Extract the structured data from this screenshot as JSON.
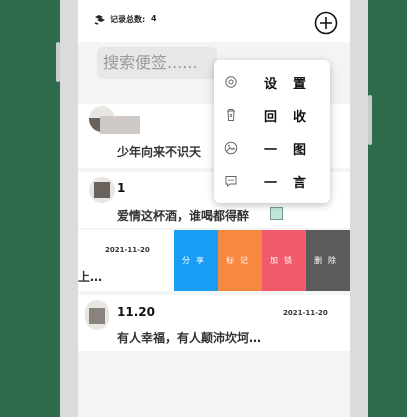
{
  "header": {
    "count_label": "记录总数:",
    "count_value": "4"
  },
  "search": {
    "placeholder": "搜索便签......"
  },
  "notes": [
    {
      "title": "",
      "body": "少年向来不识天",
      "date": ""
    },
    {
      "title": "1",
      "body": "爱情这杯酒，谁喝都得醉",
      "date": ""
    },
    {
      "title": "",
      "body": "上…",
      "date": "2021-11-20"
    },
    {
      "title": "11.20",
      "body": "有人幸福，有人颠沛坎坷…",
      "date": "2021-11-20"
    }
  ],
  "swipe_actions": [
    {
      "label": "分享",
      "color": "#1a9ef5"
    },
    {
      "label": "标记",
      "color": "#f7883f"
    },
    {
      "label": "加锁",
      "color": "#f15a6a"
    },
    {
      "label": "删除",
      "color": "#5b5b5b"
    }
  ],
  "menu": {
    "items": [
      {
        "label": "设置",
        "icon": "gear-icon"
      },
      {
        "label": "回收",
        "icon": "trash-icon"
      },
      {
        "label": "一图",
        "icon": "image-icon"
      },
      {
        "label": "一言",
        "icon": "message-icon"
      }
    ]
  },
  "colors": {
    "background": "#2e6b4c",
    "surface": "#ffffff",
    "screen": "#f3f4f4"
  }
}
